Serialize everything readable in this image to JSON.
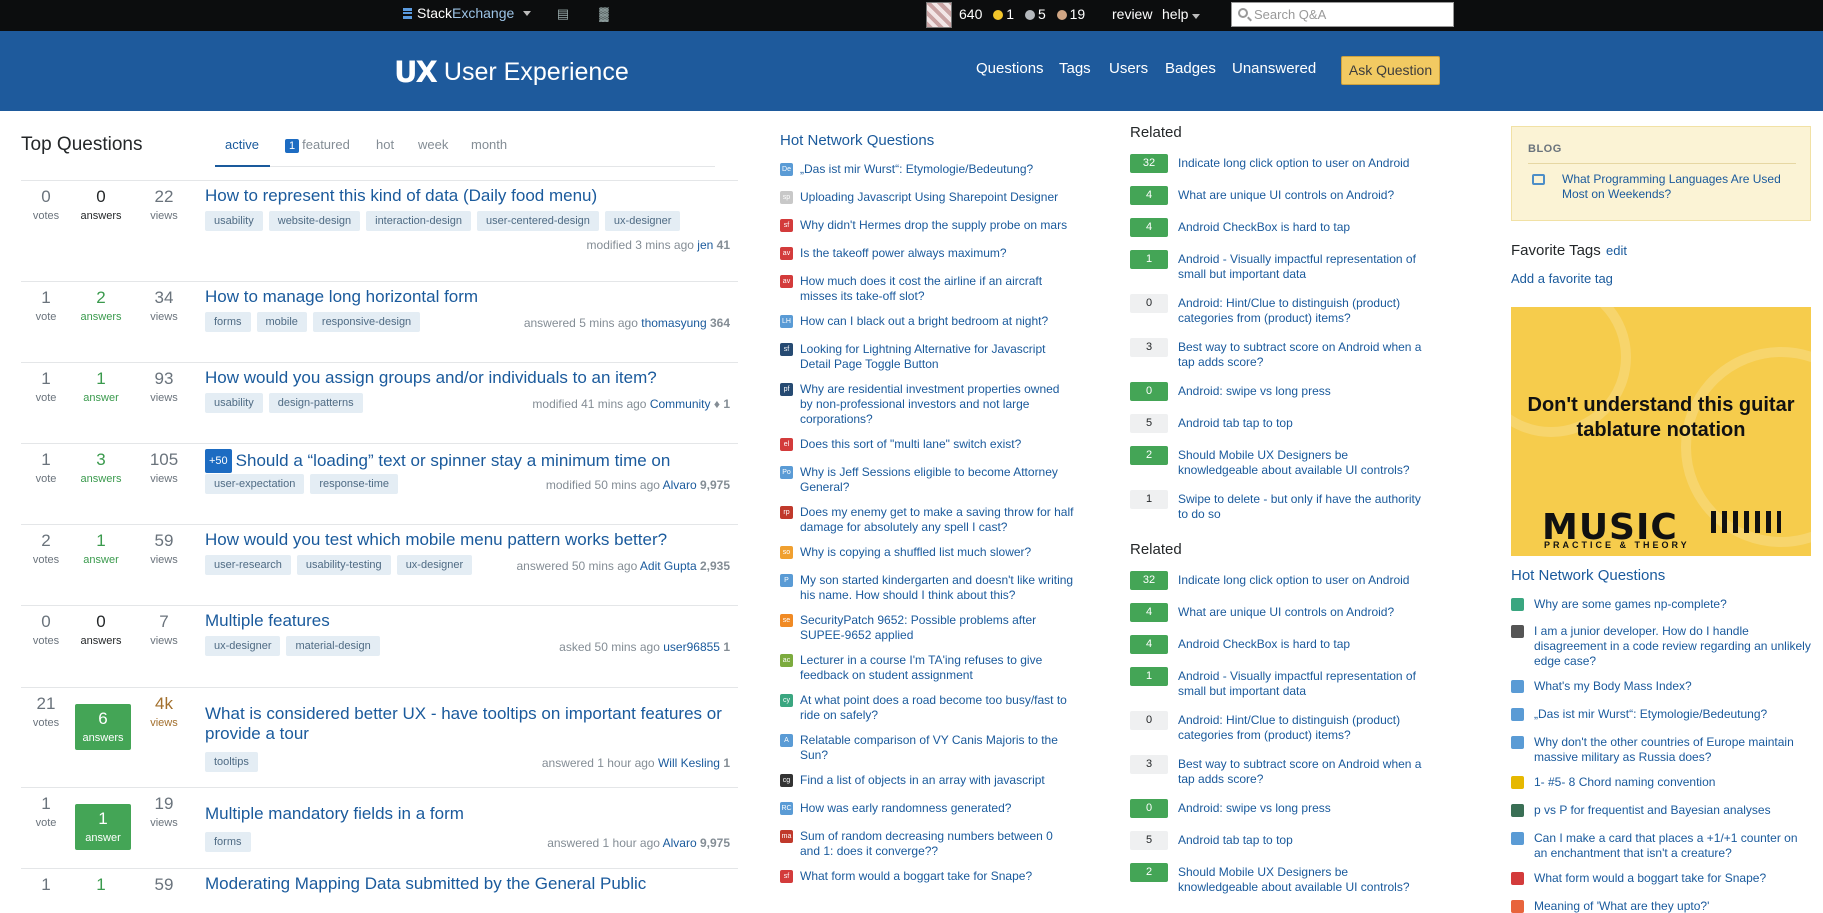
{
  "topbar": {
    "brand_a": "Stack",
    "brand_b": "Exchange",
    "reputation": "640",
    "gold": "1",
    "silver": "5",
    "bronze": "19",
    "review": "review",
    "help": "help",
    "search_placeholder": "Search Q&A",
    "colors": {
      "gold": "#f2c52a",
      "silver": "#b4b8bc",
      "bronze": "#d1a684"
    }
  },
  "header": {
    "logo_mark": "UX",
    "site_name": "User Experience",
    "nav": [
      "Questions",
      "Tags",
      "Users",
      "Badges",
      "Unanswered"
    ],
    "ask_button": "Ask Question",
    "bg_color": "#1e5a9c"
  },
  "main": {
    "title": "Top Questions",
    "tabs": {
      "active": "active",
      "featured_count": "1",
      "featured": "featured",
      "hot": "hot",
      "week": "week",
      "month": "month"
    },
    "questions": [
      {
        "votes": "0",
        "votes_label": "votes",
        "answers": "0",
        "answers_label": "answers",
        "views": "22",
        "views_label": "views",
        "title": "How to represent this kind of data (Daily food menu)",
        "tags": [
          "usability",
          "website-design",
          "interaction-design",
          "user-centered-design",
          "ux-designer"
        ],
        "action": "modified 3 mins ago",
        "user": "jen",
        "rep": "41"
      },
      {
        "votes": "1",
        "votes_label": "vote",
        "answers": "2",
        "answers_label": "answers",
        "views": "34",
        "views_label": "views",
        "title": "How to manage long horizontal form",
        "tags": [
          "forms",
          "mobile",
          "responsive-design"
        ],
        "action": "answered 5 mins ago",
        "user": "thomasyung",
        "rep": "364"
      },
      {
        "votes": "1",
        "votes_label": "vote",
        "answers": "1",
        "answers_label": "answer",
        "views": "93",
        "views_label": "views",
        "title": "How would you assign groups and/or individuals to an item?",
        "tags": [
          "usability",
          "design-patterns"
        ],
        "action": "modified 41 mins ago",
        "user": "Community",
        "rep": "♦ 1"
      },
      {
        "votes": "1",
        "votes_label": "vote",
        "answers": "3",
        "answers_label": "answers",
        "views": "105",
        "views_label": "views",
        "bounty": "+50",
        "title": "Should a “loading” text or spinner stay a minimum time on screen?",
        "tags": [
          "user-expectation",
          "response-time"
        ],
        "action": "modified 50 mins ago",
        "user": "Alvaro",
        "rep": "9,975"
      },
      {
        "votes": "2",
        "votes_label": "votes",
        "answers": "1",
        "answers_label": "answer",
        "views": "59",
        "views_label": "views",
        "title": "How would you test which mobile menu pattern works better?",
        "tags": [
          "user-research",
          "usability-testing",
          "ux-designer"
        ],
        "action": "answered 50 mins ago",
        "user": "Adit Gupta",
        "rep": "2,935"
      },
      {
        "votes": "0",
        "votes_label": "votes",
        "answers": "0",
        "answers_label": "answers",
        "views": "7",
        "views_label": "views",
        "title": "Multiple features",
        "tags": [
          "ux-designer",
          "material-design"
        ],
        "action": "asked 50 mins ago",
        "user": "user96855",
        "rep": "1"
      },
      {
        "votes": "21",
        "votes_label": "votes",
        "answers": "6",
        "answers_label": "answers",
        "views": "4k",
        "views_label": "views",
        "title": "What is considered better UX - have tooltips on important features or provide a tour",
        "tags": [
          "tooltips"
        ],
        "action": "answered 1 hour ago",
        "user": "Will Kesling",
        "rep": "1"
      },
      {
        "votes": "1",
        "votes_label": "vote",
        "answers": "1",
        "answers_label": "answer",
        "views": "19",
        "views_label": "views",
        "title": "Multiple mandatory fields in a form",
        "tags": [
          "forms"
        ],
        "action": "answered 1 hour ago",
        "user": "Alvaro",
        "rep": "9,975"
      },
      {
        "votes": "1",
        "votes_label": "",
        "answers": "1",
        "answers_label": "",
        "views": "59",
        "views_label": "",
        "title": "Moderating Mapping Data submitted by the General Public",
        "tags": [],
        "action": "",
        "user": "",
        "rep": ""
      }
    ]
  },
  "hot_network": {
    "title": "Hot Network Questions",
    "items": [
      {
        "icon": "De",
        "color": "#5a9bd5",
        "text": "„Das ist mir Wurst“: Etymologie/Bedeutung?"
      },
      {
        "icon": "sp",
        "color": "#c8c8c8",
        "text": "Uploading Javascript Using Sharepoint Designer"
      },
      {
        "icon": "sf",
        "color": "#d33b3b",
        "text": "Why didn't Hermes drop the supply probe on mars"
      },
      {
        "icon": "av",
        "color": "#d33b3b",
        "text": "Is the takeoff power always maximum?"
      },
      {
        "icon": "av",
        "color": "#d33b3b",
        "text": "How much does it cost the airline if an aircraft misses its take-off slot?"
      },
      {
        "icon": "LH",
        "color": "#5a9bd5",
        "text": "How can I black out a bright bedroom at night?"
      },
      {
        "icon": "sf",
        "color": "#264a72",
        "text": "Looking for Lightning Alternative for Javascript Detail Page Toggle Button"
      },
      {
        "icon": "pf",
        "color": "#264a72",
        "text": "Why are residential investment properties owned by non-professional investors and not large corporations?"
      },
      {
        "icon": "el",
        "color": "#d33b3b",
        "text": "Does this sort of \"multi lane\" switch exist?"
      },
      {
        "icon": "Po",
        "color": "#5a9bd5",
        "text": "Why is Jeff Sessions eligible to become Attorney General?"
      },
      {
        "icon": "rp",
        "color": "#c0392b",
        "text": "Does my enemy get to make a saving throw for half damage for absolutely any spell I cast?"
      },
      {
        "icon": "so",
        "color": "#f0a030",
        "text": "Why is copying a shuffled list much slower?"
      },
      {
        "icon": "P",
        "color": "#5a9bd5",
        "text": "My son started kindergarten and doesn't like writing his name. How should I think about this?"
      },
      {
        "icon": "se",
        "color": "#f08a24",
        "text": "SecurityPatch 9652: Possible problems after SUPEE-9652 applied"
      },
      {
        "icon": "ac",
        "color": "#7cab3e",
        "text": "Lecturer in a course I'm TA'ing refuses to give feedback on student assignment"
      },
      {
        "icon": "cy",
        "color": "#3aa680",
        "text": "At what point does a road become too busy/fast to ride on safely?"
      },
      {
        "icon": "A",
        "color": "#5a9bd5",
        "text": "Relatable comparison of VY Canis Majoris to the Sun?"
      },
      {
        "icon": "cg",
        "color": "#333333",
        "text": "Find a list of objects in an array with javascript"
      },
      {
        "icon": "RC",
        "color": "#5a9bd5",
        "text": "How was early randomness generated?"
      },
      {
        "icon": "ma",
        "color": "#c0392b",
        "text": "Sum of random decreasing numbers between 0 and 1: does it converge??"
      },
      {
        "icon": "sf",
        "color": "#d33b3b",
        "text": "What form would a boggart take for Snape?"
      }
    ]
  },
  "related": {
    "title": "Related",
    "items": [
      {
        "score": "32",
        "accepted": true,
        "text": "Indicate long click option to user on Android"
      },
      {
        "score": "4",
        "accepted": true,
        "text": "What are unique UI controls on Android?"
      },
      {
        "score": "4",
        "accepted": true,
        "text": "Android CheckBox is hard to tap"
      },
      {
        "score": "1",
        "accepted": true,
        "text": "Android - Visually impactful representation of small but important data"
      },
      {
        "score": "0",
        "accepted": false,
        "text": "Android: Hint/Clue to distinguish (product) categories from (product) items?"
      },
      {
        "score": "3",
        "accepted": false,
        "text": "Best way to subtract score on Android when a tap adds score?"
      },
      {
        "score": "0",
        "accepted": true,
        "text": "Android: swipe vs long press"
      },
      {
        "score": "5",
        "accepted": false,
        "text": "Android tab tap to top"
      },
      {
        "score": "2",
        "accepted": true,
        "text": "Should Mobile UX Designers be knowledgeable about available UI controls?"
      },
      {
        "score": "1",
        "accepted": false,
        "text": "Swipe to delete - but only if have the authority to do so"
      }
    ]
  },
  "sidebar": {
    "blog_label": "BLOG",
    "blog_link": "What Programming Languages Are Used Most on Weekends?",
    "favorite_tags": "Favorite Tags",
    "edit": "edit",
    "add_favorite": "Add a favorite tag",
    "ad_text": "Don't understand this guitar tablature notation",
    "ad_brand": "MUSIC",
    "ad_sub": "PRACTICE & THEORY",
    "hot_title": "Hot Network Questions",
    "hot_items": [
      {
        "color": "#3aa680",
        "text": "Why are some games np-complete?"
      },
      {
        "color": "#555555",
        "text": "I am a junior developer. How do I handle disagreement in a code review regarding an unlikely edge case?"
      },
      {
        "color": "#5a9bd5",
        "text": "What's my Body Mass Index?"
      },
      {
        "color": "#5a9bd5",
        "text": "„Das ist mir Wurst“: Etymologie/Bedeutung?"
      },
      {
        "color": "#5a9bd5",
        "text": "Why don't the other countries of Europe maintain massive military as Russia does?"
      },
      {
        "color": "#e6b800",
        "text": "1- #5- 8 Chord naming convention"
      },
      {
        "color": "#3a6f55",
        "text": "p vs P for frequentist and Bayesian analyses"
      },
      {
        "color": "#5a9bd5",
        "text": "Can I make a card that places a +1/+1 counter on an enchantment that isn't a creature?"
      },
      {
        "color": "#d33b3b",
        "text": "What form would a boggart take for Snape?"
      },
      {
        "color": "#e8643c",
        "text": "Meaning of 'What are they upto?'"
      }
    ]
  }
}
